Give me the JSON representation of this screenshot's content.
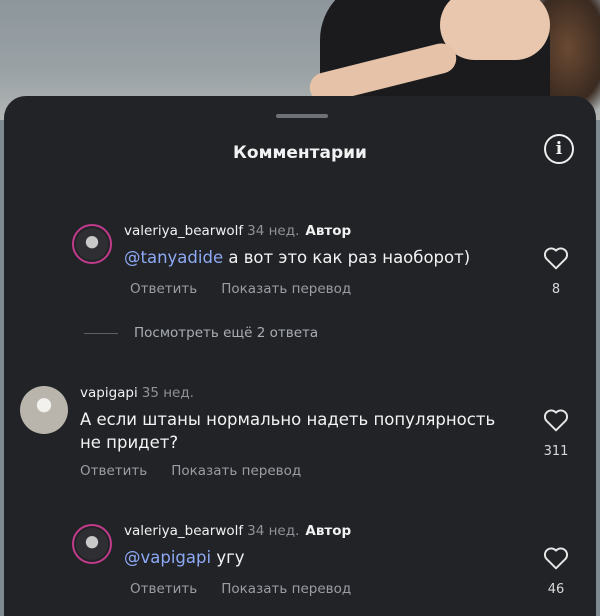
{
  "sheet": {
    "title": "Комментарии"
  },
  "comments": [
    {
      "username": "valeriya_bearwolf",
      "time": "34 нед.",
      "author_badge": "Автор",
      "mention": "@tanyadide",
      "text": " а вот это как раз наоборот)",
      "reply": "Ответить",
      "translate": "Показать перевод",
      "likes": "8"
    },
    {
      "username": "vapigapi",
      "time": "35 нед.",
      "text": "А если штаны нормально надеть популярность не придет?",
      "reply": "Ответить",
      "translate": "Показать перевод",
      "likes": "311"
    },
    {
      "username": "valeriya_bearwolf",
      "time": "34 нед.",
      "author_badge": "Автор",
      "mention": "@vapigapi",
      "text": " угу",
      "reply": "Ответить",
      "translate": "Показать перевод",
      "likes": "46"
    }
  ],
  "more_replies": "Посмотреть ещё 2 ответа",
  "colors": {
    "sheet_bg": "#212327",
    "mention": "#8ea9f5",
    "story_ring": "#c23a8b"
  },
  "icons": [
    "info-icon",
    "heart-icon"
  ]
}
